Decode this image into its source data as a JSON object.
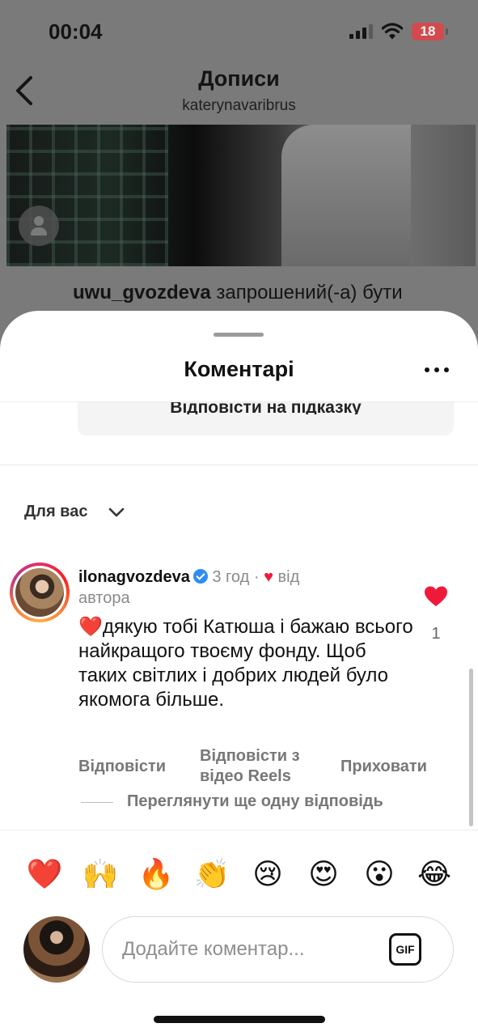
{
  "status_bar": {
    "time": "00:04",
    "battery": "18",
    "battery_color": "#d34a4e"
  },
  "background_page": {
    "title": "Дописи",
    "subtitle": "katerynavaribrus",
    "caption_username": "uwu_gvozdeva",
    "caption_text": " запрошений(-а) бути"
  },
  "sheet": {
    "title": "Коментарі",
    "reply_to_prompt": "Відповісти на підказку",
    "filter_label": "Для вас"
  },
  "comment": {
    "username": "ilonagvozdeva",
    "time": "3 год",
    "liked_by_author_suffix": "від автора",
    "text_heart": "❤️",
    "text": "дякую тобі Катюша і бажаю всього найкращого твоєму фонду. Щоб таких світлих і добрих людей було якомога більше.",
    "like_count": "1",
    "actions": {
      "reply": "Відповісти",
      "reply_reels": "Відповісти з відео Reels",
      "hide": "Приховати"
    },
    "view_more_replies": "Переглянути ще одну відповідь"
  },
  "quick_emojis": [
    "❤️",
    "🙌",
    "🔥",
    "👏",
    "😢",
    "😍",
    "😮",
    "😂"
  ],
  "composer": {
    "placeholder": "Додайте коментар...",
    "gif_label": "GIF"
  },
  "colors": {
    "like_red": "#ef1a3a",
    "verified_blue": "#2f8df3",
    "muted_text": "#777777"
  },
  "icons": [
    "back-arrow-icon",
    "more-icon",
    "chevron-down-icon",
    "verified-icon",
    "heart-icon",
    "gif-icon",
    "user-tag-icon",
    "signal-icon",
    "wifi-icon",
    "battery-icon"
  ]
}
